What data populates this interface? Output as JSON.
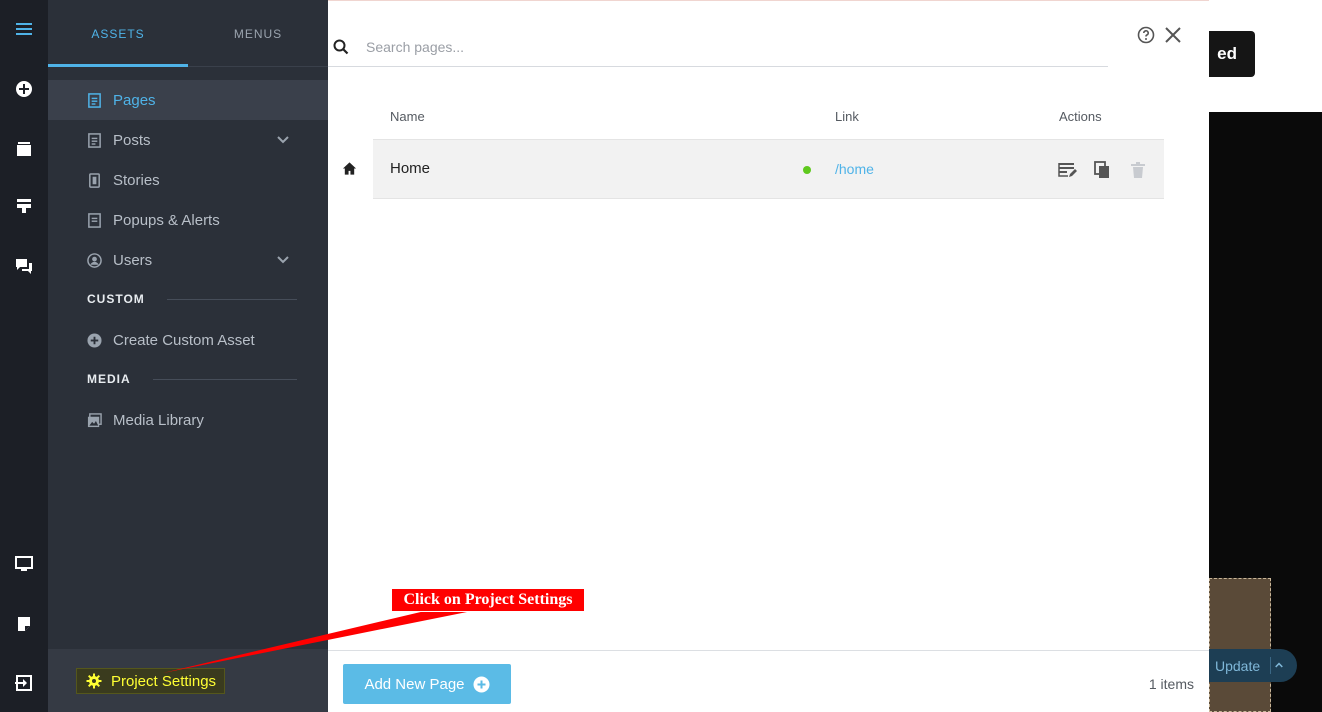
{
  "tabs": {
    "assets": "ASSETS",
    "menus": "MENUS"
  },
  "nav": {
    "pages": "Pages",
    "posts": "Posts",
    "stories": "Stories",
    "popups": "Popups & Alerts",
    "users": "Users",
    "custom_heading": "CUSTOM",
    "create_custom": "Create Custom Asset",
    "media_heading": "MEDIA",
    "media_library": "Media Library"
  },
  "footer": {
    "project_settings": "Project Settings"
  },
  "search": {
    "placeholder": "Search pages..."
  },
  "table": {
    "headers": {
      "name": "Name",
      "link": "Link",
      "actions": "Actions"
    },
    "rows": [
      {
        "name": "Home",
        "link": "/home",
        "status": "published"
      }
    ]
  },
  "modal_footer": {
    "add_label": "Add New Page",
    "count": "1 items"
  },
  "background": {
    "button_text": "ed",
    "update_label": "Update"
  },
  "annotation": {
    "text": "Click on Project Settings"
  },
  "colors": {
    "accent": "#4fb3e8",
    "status_green": "#5fc91e",
    "highlight_yellow": "#ffff33",
    "callout_red": "#ff0000"
  }
}
